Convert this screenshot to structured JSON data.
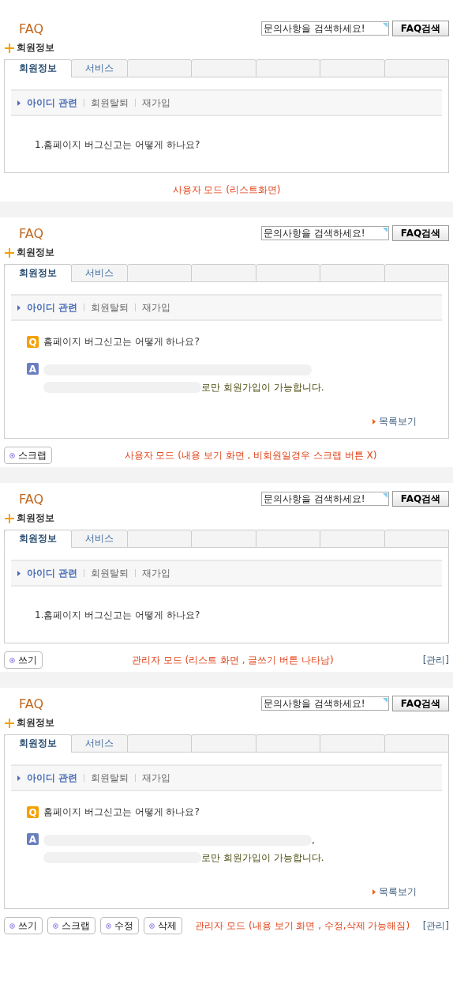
{
  "panels": [
    {
      "title": "FAQ",
      "search": {
        "placeholder": "문의사항을 검색하세요!",
        "button": "FAQ검색"
      },
      "section": "회원정보",
      "tabs": [
        {
          "label": "회원정보",
          "selected": true
        },
        {
          "label": "서비스",
          "selected": false
        },
        {
          "selected": false
        },
        {
          "selected": false
        },
        {
          "selected": false
        },
        {
          "selected": false
        },
        {
          "selected": false
        }
      ],
      "subtabs": [
        {
          "label": "아이디 관련",
          "selected": true
        },
        {
          "label": "회원탈퇴",
          "selected": false
        },
        {
          "label": "재가입",
          "selected": false
        }
      ],
      "content": {
        "kind": "list",
        "items": [
          "1.홈페이지 버그신고는 어떻게 하나요?"
        ]
      },
      "caption": "사용자 모드 (리스트화면)"
    },
    {
      "title": "FAQ",
      "search": {
        "placeholder": "문의사항을 검색하세요!",
        "button": "FAQ검색"
      },
      "section": "회원정보",
      "tabs": [
        {
          "label": "회원정보",
          "selected": true
        },
        {
          "label": "서비스",
          "selected": false
        },
        {
          "selected": false
        },
        {
          "selected": false
        },
        {
          "selected": false
        },
        {
          "selected": false
        },
        {
          "selected": false
        }
      ],
      "subtabs": [
        {
          "label": "아이디 관련",
          "selected": true
        },
        {
          "label": "회원탈퇴",
          "selected": false
        },
        {
          "label": "재가입",
          "selected": false
        }
      ],
      "content": {
        "kind": "view",
        "q_badge": "Q",
        "question": "홈페이지 버그신고는 어떻게 하나요?",
        "a_badge": "A",
        "answer_lines": [
          {
            "redacted": true
          },
          {
            "redacted": true,
            "text": "로만 회원가입이 가능합니다."
          }
        ],
        "list_link": "목록보기"
      },
      "buttons": [
        "스크랩"
      ],
      "caption": "사용자 모드 (내용 보기 화면 , 비회원일경우 스크랩 버튼 X)"
    },
    {
      "title": "FAQ",
      "search": {
        "placeholder": "문의사항을 검색하세요!",
        "button": "FAQ검색"
      },
      "section": "회원정보",
      "tabs": [
        {
          "label": "회원정보",
          "selected": true
        },
        {
          "label": "서비스",
          "selected": false
        },
        {
          "selected": false
        },
        {
          "selected": false
        },
        {
          "selected": false
        },
        {
          "selected": false
        },
        {
          "selected": false
        }
      ],
      "subtabs": [
        {
          "label": "아이디 관련",
          "selected": true
        },
        {
          "label": "회원탈퇴",
          "selected": false
        },
        {
          "label": "재가입",
          "selected": false
        }
      ],
      "content": {
        "kind": "list",
        "items": [
          "1.홈페이지 버그신고는 어떻게 하나요?"
        ]
      },
      "buttons": [
        "쓰기"
      ],
      "caption": "관리자 모드 (리스트 화면 , 글쓰기 버튼 나타남)",
      "admin_link": "[관리]"
    },
    {
      "title": "FAQ",
      "search": {
        "placeholder": "문의사항을 검색하세요!",
        "button": "FAQ검색"
      },
      "section": "회원정보",
      "tabs": [
        {
          "label": "회원정보",
          "selected": true
        },
        {
          "label": "서비스",
          "selected": false
        },
        {
          "selected": false
        },
        {
          "selected": false
        },
        {
          "selected": false
        },
        {
          "selected": false
        },
        {
          "selected": false
        }
      ],
      "subtabs": [
        {
          "label": "아이디 관련",
          "selected": true
        },
        {
          "label": "회원탈퇴",
          "selected": false
        },
        {
          "label": "재가입",
          "selected": false
        }
      ],
      "content": {
        "kind": "view",
        "q_badge": "Q",
        "question": "홈페이지 버그신고는 어떻게 하나요?",
        "a_badge": "A",
        "answer_lines": [
          {
            "redacted": true,
            "text": ","
          },
          {
            "redacted": true,
            "text": "로만 회원가입이 가능합니다."
          }
        ],
        "list_link": "목록보기"
      },
      "buttons": [
        "쓰기",
        "스크랩",
        "수정",
        "삭제"
      ],
      "caption": "관리자 모드 (내용 보기 화면 , 수정,삭제 가능해짐)",
      "admin_link": "[관리]"
    }
  ]
}
